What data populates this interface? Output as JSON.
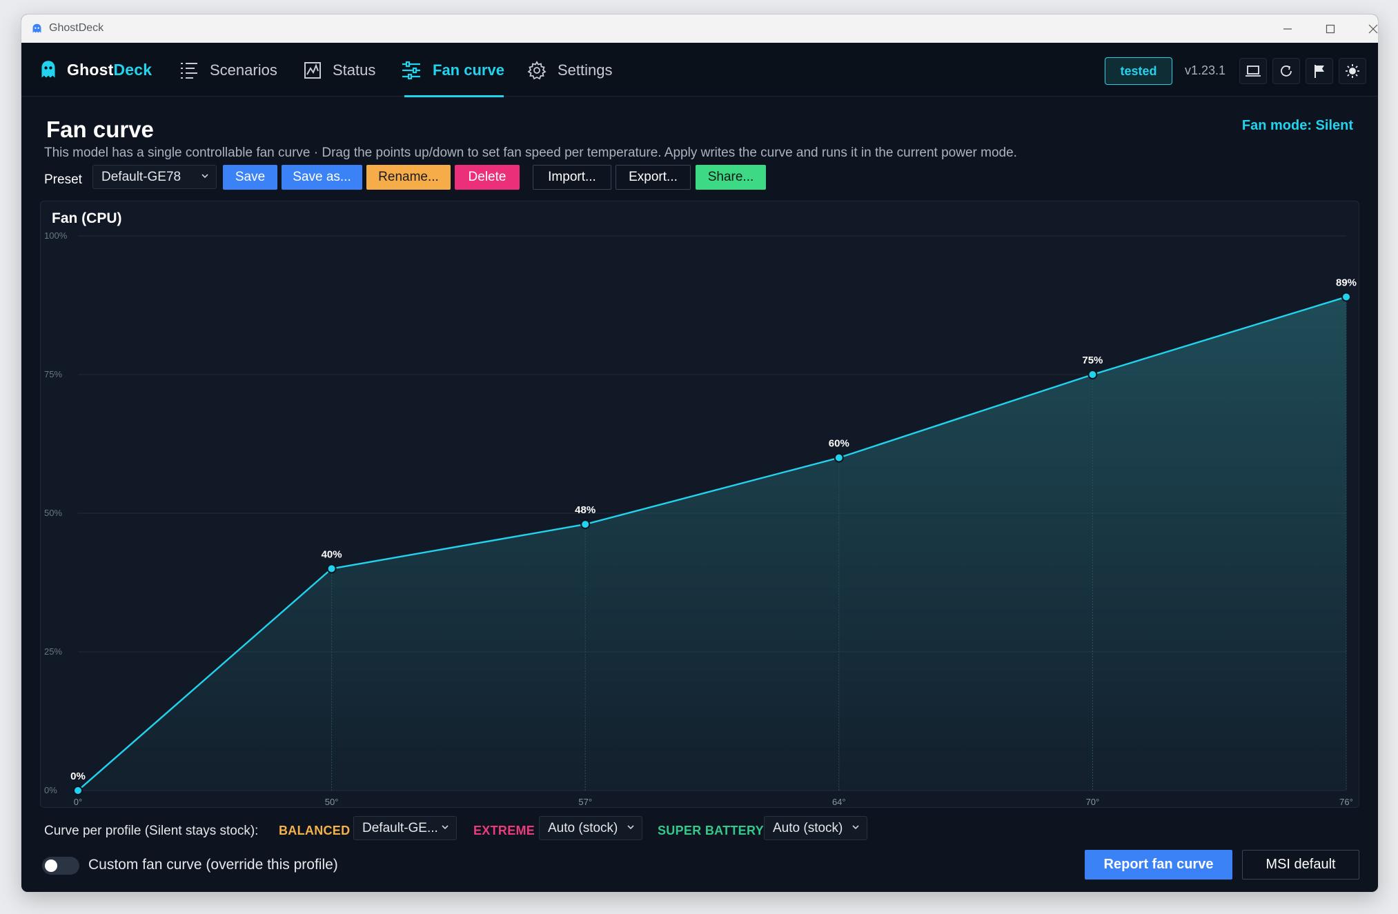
{
  "window": {
    "title": "GhostDeck"
  },
  "brand": {
    "name_part1": "Ghost",
    "name_part2": "Deck"
  },
  "nav": {
    "tabs": [
      {
        "label": "Scenarios",
        "icon": "list-icon"
      },
      {
        "label": "Status",
        "icon": "chart-icon"
      },
      {
        "label": "Fan curve",
        "icon": "sliders-icon",
        "active": true
      },
      {
        "label": "Settings",
        "icon": "gear-icon"
      }
    ]
  },
  "header": {
    "badge": "tested",
    "version": "v1.23.1",
    "icons": [
      "laptop-icon",
      "refresh-icon",
      "flag-icon",
      "sun-icon"
    ]
  },
  "page": {
    "title": "Fan curve",
    "fan_mode": "Fan mode: Silent",
    "subtitle": "This model has a single controllable fan curve  ·  Drag the points up/down to set fan speed per temperature. Apply writes the curve and runs it in the current power mode."
  },
  "preset": {
    "label": "Preset",
    "selected": "Default-GE78",
    "buttons": {
      "save": "Save",
      "save_as": "Save as...",
      "rename": "Rename...",
      "delete": "Delete",
      "import": "Import...",
      "export": "Export...",
      "share": "Share..."
    }
  },
  "chart_data": {
    "type": "area",
    "title": "Fan (CPU)",
    "x": [
      "0°",
      "50°",
      "57°",
      "64°",
      "70°",
      "76°"
    ],
    "values": [
      0,
      40,
      48,
      60,
      75,
      89
    ],
    "point_labels": [
      "0%",
      "40%",
      "48%",
      "60%",
      "75%",
      "89%"
    ],
    "y_ticks": [
      "0%",
      "25%",
      "50%",
      "75%",
      "100%"
    ],
    "ylim": [
      0,
      100
    ],
    "grid": true,
    "line_color": "#22d3ee",
    "fill_color": "#1f4f5a"
  },
  "profiles": {
    "label": "Curve per profile (Silent stays stock):",
    "items": [
      {
        "name": "BALANCED",
        "color": "#f6b24a",
        "value": "Default-GE..."
      },
      {
        "name": "EXTREME",
        "color": "#ec3b7c",
        "value": "Auto (stock)"
      },
      {
        "name": "SUPER BATTERY",
        "color": "#34c98a",
        "value": "Auto (stock)"
      }
    ]
  },
  "custom_toggle": {
    "label": "Custom fan curve (override this profile)",
    "on": false
  },
  "footer": {
    "report": "Report fan curve",
    "msi_default": "MSI default"
  }
}
